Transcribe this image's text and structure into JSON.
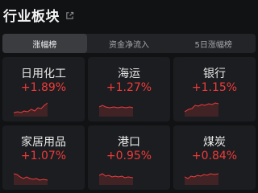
{
  "header": {
    "title": "行业板块"
  },
  "tabs": [
    {
      "label": "涨幅榜",
      "active": true
    },
    {
      "label": "资金净流入",
      "active": false
    },
    {
      "label": "5日涨幅榜",
      "active": false
    }
  ],
  "cards": [
    {
      "name": "日用化工",
      "change": "+1.89%"
    },
    {
      "name": "海运",
      "change": "+1.27%"
    },
    {
      "name": "银行",
      "change": "+1.15%"
    },
    {
      "name": "家居用品",
      "change": "+1.07%"
    },
    {
      "name": "港口",
      "change": "+0.95%"
    },
    {
      "name": "煤炭",
      "change": "+0.84%"
    }
  ],
  "colors": {
    "up": "#ef3b3b",
    "background": "#111214",
    "card": "#1c1d20"
  },
  "icons": {
    "share": "share-out-icon"
  }
}
